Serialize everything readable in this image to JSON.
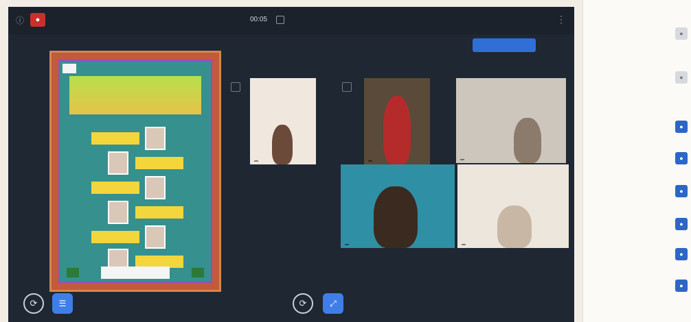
{
  "window": {
    "timer": "00:05",
    "title": "",
    "present_label": "",
    "aux_label": ""
  },
  "slide": {
    "title_lines": ""
  },
  "tiles": [
    {
      "name": ""
    },
    {
      "name": ""
    },
    {
      "name": ""
    },
    {
      "name": ""
    },
    {
      "name": ""
    }
  ],
  "controls": {
    "left_round": "⟳",
    "left_sq": "☰",
    "center_round": "⟳",
    "center_sq": "⤢"
  },
  "chat_preview": "",
  "sidebar": {
    "header": "",
    "sections": [
      "",
      "",
      ""
    ],
    "items": [
      {
        "name": ""
      },
      {
        "name": ""
      },
      {
        "name": ""
      },
      {
        "name": ""
      },
      {
        "name": ""
      },
      {
        "name": ""
      },
      {
        "name": ""
      },
      {
        "name": ""
      }
    ]
  },
  "colors": {
    "window_bg": "#1f2732",
    "accent": "#2f6fd6",
    "record": "#c9302c",
    "panel_bg": "#fbfaf7"
  }
}
